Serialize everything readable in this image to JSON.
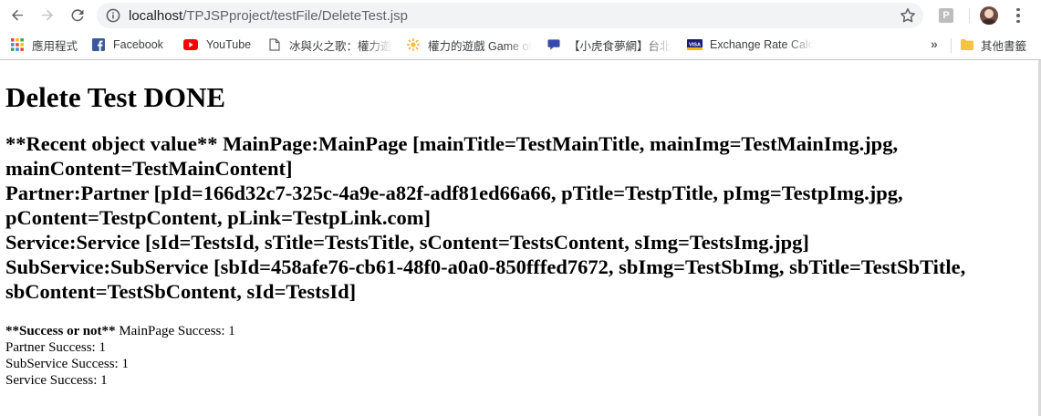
{
  "browser": {
    "url_host": "localhost",
    "url_path": "/TPJSPproject/testFile/DeleteTest.jsp",
    "extension_label": "P",
    "icons": [
      "back-icon",
      "forward-icon",
      "reload-icon",
      "info-icon",
      "star-icon",
      "menu-icon"
    ],
    "accent_color": "#1a73e8"
  },
  "bookmarks": {
    "items": [
      {
        "label": "應用程式"
      },
      {
        "label": "Facebook"
      },
      {
        "label": "YouTube"
      },
      {
        "label": "冰與火之歌：權力遊"
      },
      {
        "label": "權力的遊戲 Game of"
      },
      {
        "label": "【小虎食夢網】台北"
      },
      {
        "label": "Exchange Rate Calc"
      },
      {
        "label": "其他書籤"
      }
    ],
    "overflow": "»",
    "visa_label": "VISA"
  },
  "page": {
    "heading": "Delete Test DONE",
    "recent_lines": [
      "**Recent object value** MainPage:MainPage [mainTitle=TestMainTitle, mainImg=TestMainImg.jpg,",
      "mainContent=TestMainContent]",
      "Partner:Partner [pId=166d32c7-325c-4a9e-a82f-adf81ed66a66, pTitle=TestpTitle, pImg=TestpImg.jpg,",
      "pContent=TestpContent, pLink=TestpLink.com]",
      "Service:Service [sId=TestsId, sTitle=TestsTitle, sContent=TestsContent, sImg=TestsImg.jpg]",
      "SubService:SubService [sbId=458afe76-cb61-48f0-a0a0-850fffed7672, sbImg=TestSbImg, sbTitle=TestSbTitle,",
      "sbContent=TestSbContent, sId=TestsId]"
    ],
    "success_label": "**Success or not**",
    "success_first": " MainPage Success: 1",
    "success_lines": [
      "Partner Success: 1",
      "SubService Success: 1",
      "Service Success: 1"
    ]
  }
}
